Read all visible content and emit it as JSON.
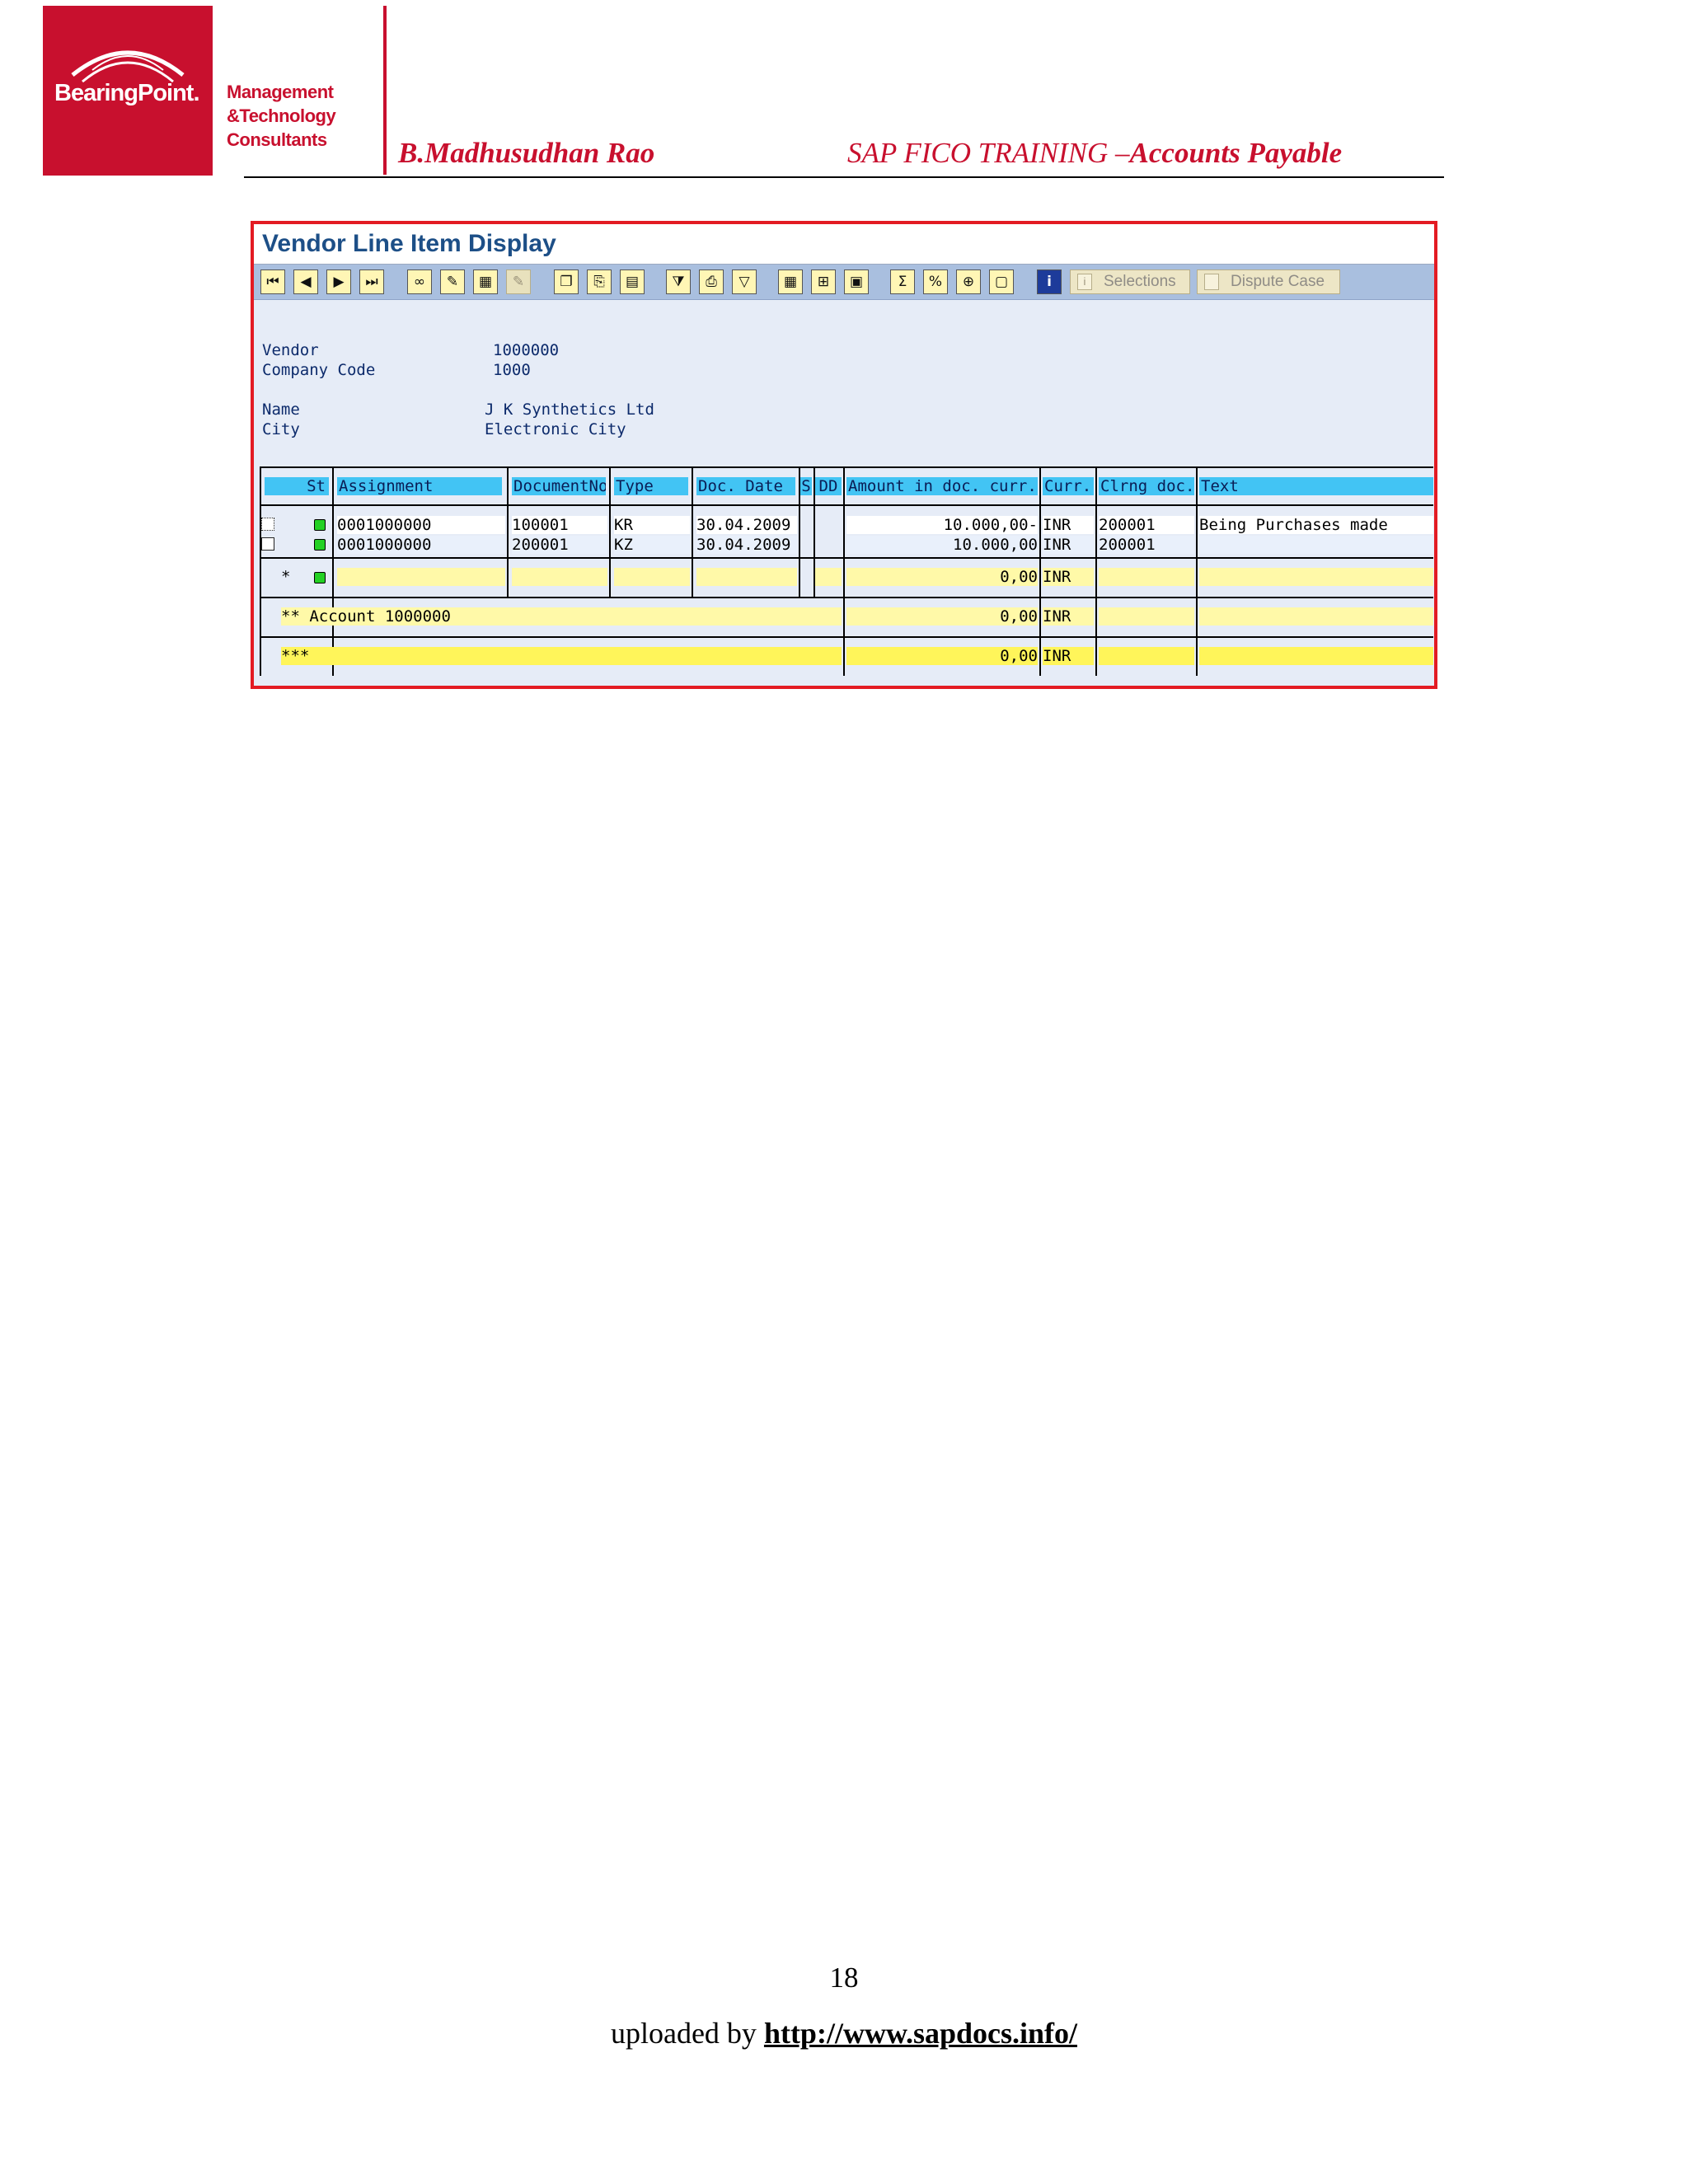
{
  "header": {
    "logo_text": "BearingPoint.",
    "logo_side": [
      "Management",
      "&Technology",
      "Consultants"
    ],
    "author": "B.Madhusudhan Rao",
    "course_prefix": "SAP FICO TRAINING –",
    "course_bold": "Accounts Payable",
    "brand_color": "#c8102e"
  },
  "sap": {
    "title": "Vendor Line Item Display",
    "toolbar": {
      "icons": [
        "first-page-icon",
        "previous-page-icon",
        "next-page-icon",
        "last-page-icon",
        "glasses-icon",
        "pencil-icon",
        "select-layout-icon",
        "disabled-change-icon",
        "copy-icon",
        "paste-icon",
        "details-icon",
        "filter-icon",
        "print-icon",
        "subtotal-filter-icon",
        "table-icon",
        "insert-column-icon",
        "layout-icon",
        "sum-icon",
        "percent-icon",
        "expand-icon",
        "clipboard-icon",
        "info-icon"
      ],
      "selections_label": "Selections",
      "dispute_label": "Dispute Case"
    },
    "fields": {
      "vendor_label": "Vendor",
      "vendor_value": "1000000",
      "company_label": "Company Code",
      "company_value": "1000",
      "name_label": "Name",
      "name_value": "J K Synthetics Ltd",
      "city_label": "City",
      "city_value": "Electronic City"
    },
    "columns": {
      "st": "St",
      "assignment": "Assignment",
      "docno": "DocumentNo",
      "type": "Type",
      "docdate": "Doc. Date",
      "s": "S",
      "dd": "DD",
      "amount": "Amount in doc. curr.",
      "curr": "Curr.",
      "clrng": "Clrng doc.",
      "text": "Text"
    },
    "rows": [
      {
        "assignment": "0001000000",
        "docno": "100001",
        "type": "KR",
        "docdate": "30.04.2009",
        "amount": "10.000,00-",
        "curr": "INR",
        "clrng": "200001",
        "text": "Being Purchases made"
      },
      {
        "assignment": "0001000000",
        "docno": "200001",
        "type": "KZ",
        "docdate": "30.04.2009",
        "amount": "10.000,00",
        "curr": "INR",
        "clrng": "200001",
        "text": ""
      }
    ],
    "totals": [
      {
        "label": "*",
        "amount": "0,00",
        "curr": "INR"
      },
      {
        "label": "** Account 1000000",
        "amount": "0,00",
        "curr": "INR"
      },
      {
        "label": "***",
        "amount": "0,00",
        "curr": "INR"
      }
    ]
  },
  "footer": {
    "page_number": "18",
    "uploaded_prefix": "uploaded by",
    "uploaded_link": "http://www.sapdocs.info/"
  }
}
